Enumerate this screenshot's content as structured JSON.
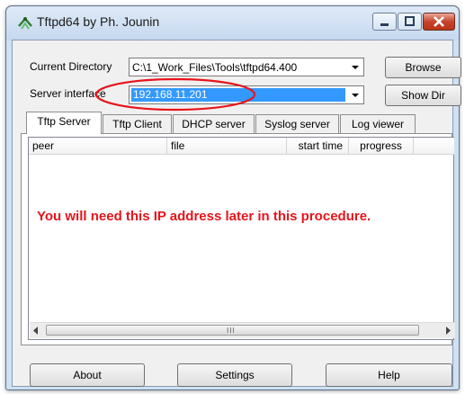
{
  "window": {
    "title": "Tftpd64 by Ph. Jounin"
  },
  "fields": {
    "current_directory_label": "Current Directory",
    "current_directory_value": "C:\\1_Work_Files\\Tools\\tftpd64.400",
    "server_interface_label": "Server interface",
    "server_interface_value": "192.168.11.201"
  },
  "buttons": {
    "browse": "Browse",
    "show_dir": "Show Dir",
    "about": "About",
    "settings": "Settings",
    "help": "Help"
  },
  "tabs": [
    {
      "label": "Tftp Server",
      "active": true
    },
    {
      "label": "Tftp Client",
      "active": false
    },
    {
      "label": "DHCP server",
      "active": false
    },
    {
      "label": "Syslog server",
      "active": false
    },
    {
      "label": "Log viewer",
      "active": false
    }
  ],
  "table": {
    "columns": [
      "peer",
      "file",
      "start time",
      "progress"
    ]
  },
  "annotation": {
    "text": "You will need this IP address later in this procedure.",
    "color": "#e8141b"
  },
  "scrollbar": {
    "grip": "III"
  },
  "colors": {
    "selection": "#3399ff",
    "highlight_ellipse": "#e8141b",
    "close_button": "#c8432b"
  }
}
